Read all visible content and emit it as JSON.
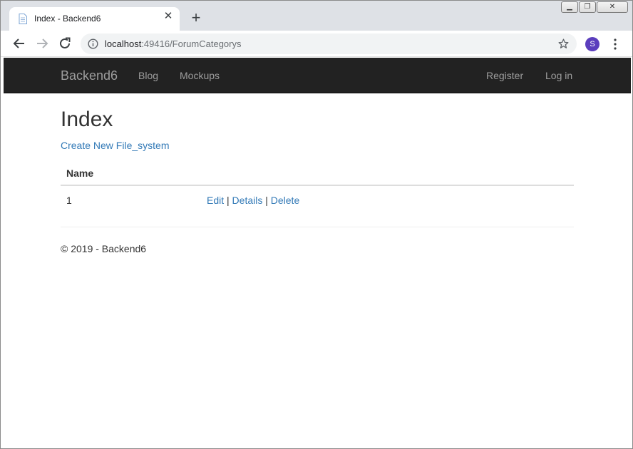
{
  "browser": {
    "tab_title": "Index - Backend6",
    "tab_close_glyph": "✕",
    "new_tab_glyph": "+",
    "url_host": "localhost",
    "url_rest": ":49416/ForumCategorys",
    "profile_initial": "S",
    "window_controls": {
      "minimize": "▁",
      "restore": "❐",
      "close": "✕"
    }
  },
  "navbar": {
    "brand": "Backend6",
    "left_links": [
      "Blog",
      "Mockups"
    ],
    "right_links": [
      "Register",
      "Log in"
    ]
  },
  "main": {
    "title": "Index",
    "create_link": "Create New File_system",
    "table": {
      "headers": [
        "Name"
      ],
      "rows": [
        {
          "name": "1",
          "actions": [
            "Edit",
            "Details",
            "Delete"
          ],
          "separator": "|"
        }
      ]
    }
  },
  "footer": {
    "text": "© 2019 - Backend6"
  },
  "colors": {
    "navbar_bg": "#222222",
    "link": "#337ab7",
    "nav_text": "#9d9d9d",
    "avatar": "#5b3ebd"
  },
  "icons": [
    "page-icon",
    "close-icon",
    "plus-icon",
    "back-arrow-icon",
    "forward-arrow-icon",
    "reload-icon",
    "info-icon",
    "star-icon",
    "kebab-menu-icon"
  ]
}
